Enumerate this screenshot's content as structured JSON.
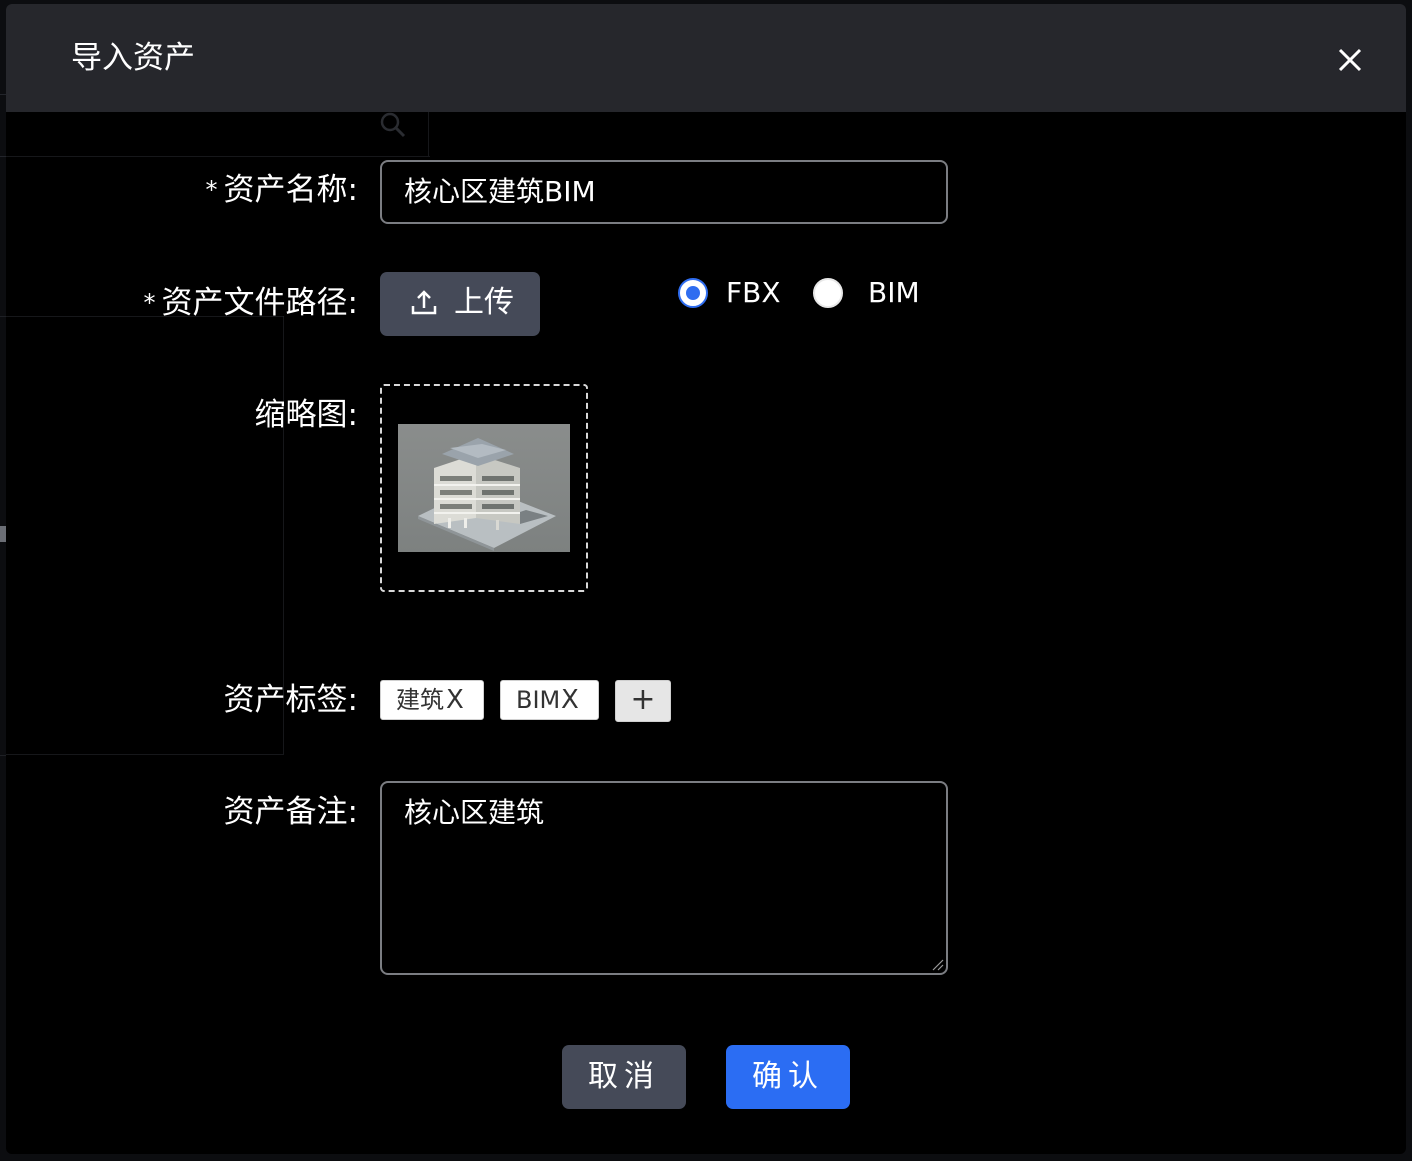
{
  "dialog": {
    "title": "导入资产",
    "close_label": "X"
  },
  "form": {
    "name": {
      "required_mark": "*",
      "label": "资产名称:",
      "value": "核心区建筑BIM"
    },
    "file_path": {
      "required_mark": "*",
      "label": "资产文件路径:",
      "upload_label": "上传",
      "options": [
        {
          "label": "FBX",
          "checked": true
        },
        {
          "label": "BIM",
          "checked": false
        }
      ]
    },
    "thumbnail": {
      "label": "缩略图:"
    },
    "tags": {
      "label": "资产标签:",
      "items": [
        {
          "text": "建筑",
          "close": "X"
        },
        {
          "text": "BIM",
          "close": "X"
        }
      ],
      "add_label": "+"
    },
    "remark": {
      "label": "资产备注:",
      "value": "核心区建筑"
    }
  },
  "actions": {
    "cancel_label": "取消",
    "confirm_label": "确认"
  },
  "colors": {
    "accent": "#2b6df3",
    "secondary_button": "#454a58",
    "header_bg": "#26272c"
  }
}
